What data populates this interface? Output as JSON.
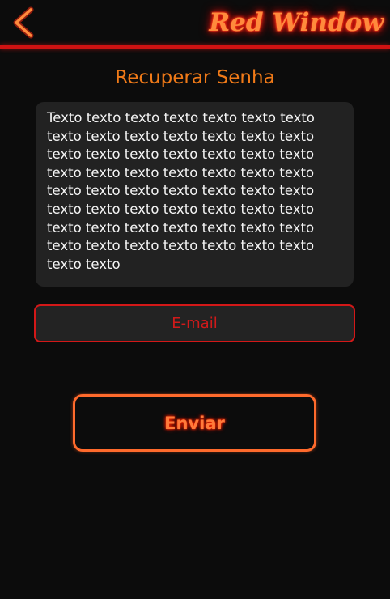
{
  "header": {
    "back_icon": "chevron-left-icon",
    "brand": "Red Window"
  },
  "page": {
    "title": "Recuperar Senha",
    "description": "Texto texto texto texto texto texto texto texto texto texto texto texto texto texto texto texto texto texto texto texto texto texto texto texto texto texto texto texto texto texto texto texto texto texto texto texto texto texto texto texto texto texto texto texto texto texto texto texto texto texto texto texto texto texto texto texto texto texto"
  },
  "form": {
    "email_placeholder": "E-mail",
    "email_value": "",
    "submit_label": "Enviar"
  },
  "colors": {
    "background": "#0c0c0c",
    "accent_orange": "#f07a18",
    "accent_red": "#d31818",
    "neon_orange": "#ff6a2c",
    "box_background": "#222222"
  }
}
